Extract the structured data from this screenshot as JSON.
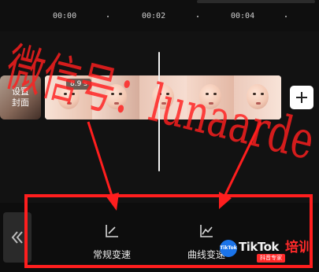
{
  "timeline": {
    "ticks": [
      "00:00",
      "00:02",
      "00:04"
    ]
  },
  "cover": {
    "label_line1": "设置",
    "label_line2": "封面"
  },
  "track": {
    "speed_badge": "8.9 s"
  },
  "toolbar": {
    "normal_speed_label": "常规变速",
    "curve_speed_label": "曲线变速"
  },
  "watermark": {
    "text": "微信号：lunaarde"
  },
  "brand": {
    "badge": "TikTok",
    "name": "TikTok",
    "suffix": "培训",
    "sub_tag": "抖音专家"
  },
  "colors": {
    "annotation": "#ff1e1e",
    "background": "#121212",
    "badge_blue": "#1a73e8"
  },
  "icons": {
    "back": "double-chevron-left-icon",
    "normal_speed": "diagonal-line-icon",
    "curve_speed": "line-chart-icon",
    "add": "plus-icon"
  }
}
